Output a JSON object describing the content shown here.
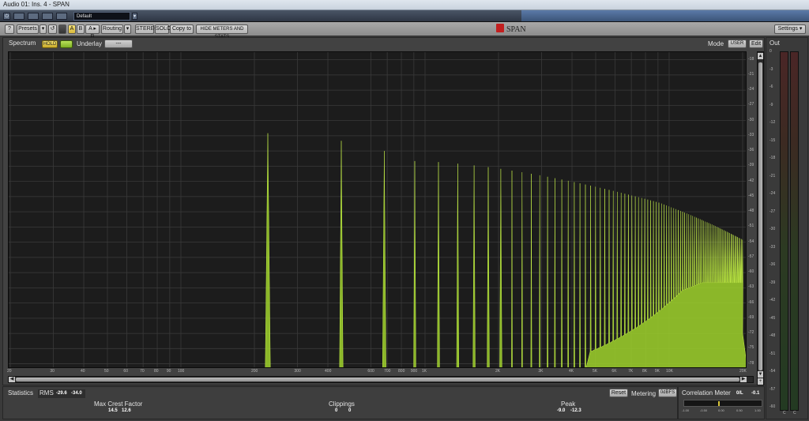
{
  "window": {
    "title": "Audio 01: Ins. 4 - SPAN"
  },
  "host": {
    "preset_name": "Default",
    "buttons": [
      "",
      "",
      "",
      "",
      ""
    ]
  },
  "toolbar": {
    "help": "?",
    "presets": "Presets",
    "undo": "↺",
    "a": "A",
    "b": "B",
    "a_to_b": "A ▸ B",
    "routing": "Routing",
    "stereo": "STEREO",
    "solo": "SOLO",
    "copy_to": "Copy to",
    "hide_meters": "HIDE METERS AND STATS",
    "brand": "SPAN",
    "settings": "Settings"
  },
  "spectrum": {
    "label": "Spectrum",
    "hold": "HOLD",
    "underlay_label": "Underlay",
    "underlay_value": "---",
    "mode_label": "Mode",
    "mode_value": "USER",
    "edit": "Edit",
    "y_ticks": [
      "-18",
      "-21",
      "-24",
      "-27",
      "-30",
      "-33",
      "-36",
      "-39",
      "-42",
      "-45",
      "-48",
      "-51",
      "-54",
      "-57",
      "-60",
      "-63",
      "-66",
      "-69",
      "-72",
      "-75",
      "-78"
    ],
    "x_ticks": [
      {
        "label": "20",
        "f": 20
      },
      {
        "label": "30",
        "f": 30
      },
      {
        "label": "40",
        "f": 40
      },
      {
        "label": "50",
        "f": 50
      },
      {
        "label": "60",
        "f": 60
      },
      {
        "label": "70",
        "f": 70
      },
      {
        "label": "80",
        "f": 80
      },
      {
        "label": "90",
        "f": 90
      },
      {
        "label": "100",
        "f": 100
      },
      {
        "label": "200",
        "f": 200
      },
      {
        "label": "300",
        "f": 300
      },
      {
        "label": "400",
        "f": 400
      },
      {
        "label": "600",
        "f": 600
      },
      {
        "label": "700",
        "f": 700
      },
      {
        "label": "800",
        "f": 800
      },
      {
        "label": "900",
        "f": 900
      },
      {
        "label": "1K",
        "f": 1000
      },
      {
        "label": "2K",
        "f": 2000
      },
      {
        "label": "3K",
        "f": 3000
      },
      {
        "label": "4K",
        "f": 4000
      },
      {
        "label": "5K",
        "f": 5000
      },
      {
        "label": "6K",
        "f": 6000
      },
      {
        "label": "7K",
        "f": 7000
      },
      {
        "label": "8K",
        "f": 8000
      },
      {
        "label": "9K",
        "f": 9000
      },
      {
        "label": "10K",
        "f": 10000
      },
      {
        "label": "20K",
        "f": 20000
      }
    ],
    "colors": {
      "trace": "#9fd22c",
      "grid": "#3a3a3a",
      "bg": "#1c1c1c"
    }
  },
  "statistics": {
    "label": "Statistics",
    "rms_label": "RMS",
    "rms_l": "-29.6",
    "rms_r": "-34.0",
    "crest_label": "Max Crest Factor",
    "crest_l": "14.5",
    "crest_r": "12.6",
    "clip_label": "Clippings",
    "clip_l": "0",
    "clip_r": "0",
    "peak_label": "Peak",
    "peak_l": "-9.0",
    "peak_r": "-12.3",
    "reset": "Reset",
    "metering_label": "Metering",
    "metering_value": "0dBFS"
  },
  "correlation": {
    "label": "Correlation Meter",
    "mode": "0/L",
    "value": "-0.1",
    "level": -0.1,
    "scale": [
      "-1.00",
      "-0.50",
      "0.00",
      "0.50",
      "1.00"
    ]
  },
  "output": {
    "label": "Out",
    "ticks": [
      "0",
      "-3",
      "-6",
      "-9",
      "-12",
      "-15",
      "-18",
      "-21",
      "-24",
      "-27",
      "-30",
      "-33",
      "-36",
      "-39",
      "-42",
      "-45",
      "-48",
      "-51",
      "-54",
      "-57",
      "-60"
    ],
    "bottom": [
      "C",
      "C"
    ]
  }
}
